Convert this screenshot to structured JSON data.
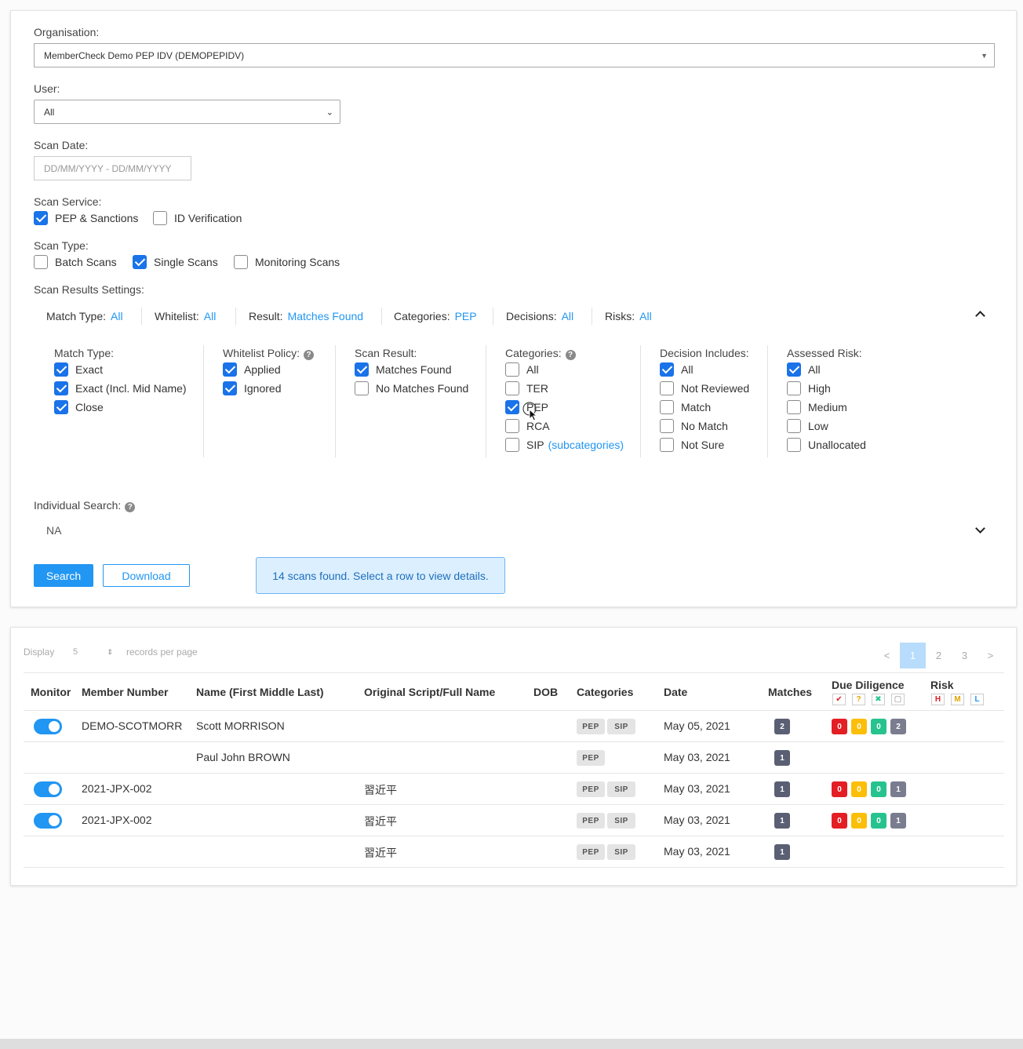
{
  "filters": {
    "organisation_label": "Organisation:",
    "organisation_value": "MemberCheck Demo PEP IDV (DEMOPEPIDV)",
    "user_label": "User:",
    "user_value": "All",
    "scan_date_label": "Scan Date:",
    "scan_date_placeholder": "DD/MM/YYYY - DD/MM/YYYY",
    "scan_service_label": "Scan Service:",
    "scan_service": [
      {
        "label": "PEP & Sanctions",
        "checked": true
      },
      {
        "label": "ID Verification",
        "checked": false
      }
    ],
    "scan_type_label": "Scan Type:",
    "scan_type": [
      {
        "label": "Batch Scans",
        "checked": false
      },
      {
        "label": "Single Scans",
        "checked": true
      },
      {
        "label": "Monitoring Scans",
        "checked": false
      }
    ],
    "results_settings_label": "Scan Results Settings:",
    "summary": [
      {
        "key": "Match Type:",
        "value": "All"
      },
      {
        "key": "Whitelist:",
        "value": "All"
      },
      {
        "key": "Result:",
        "value": "Matches Found"
      },
      {
        "key": "Categories:",
        "value": "PEP"
      },
      {
        "key": "Decisions:",
        "value": "All"
      },
      {
        "key": "Risks:",
        "value": "All"
      }
    ],
    "groups": {
      "match_type": {
        "title": "Match Type:",
        "options": [
          "Exact",
          "Exact (Incl. Mid Name)",
          "Close"
        ]
      },
      "whitelist": {
        "title": "Whitelist Policy:",
        "options": [
          "Applied",
          "Ignored"
        ]
      },
      "scan_result": {
        "title": "Scan Result:",
        "options": [
          "Matches Found",
          "No Matches Found"
        ]
      },
      "categories": {
        "title": "Categories:",
        "options": [
          "All",
          "TER",
          "PEP",
          "RCA",
          "SIP"
        ],
        "sip_link": "(subcategories)"
      },
      "decision": {
        "title": "Decision Includes:",
        "options": [
          "All",
          "Not Reviewed",
          "Match",
          "No Match",
          "Not Sure"
        ]
      },
      "risk": {
        "title": "Assessed Risk:",
        "options": [
          "All",
          "High",
          "Medium",
          "Low",
          "Unallocated"
        ]
      }
    },
    "individual_search_label": "Individual Search:",
    "individual_search_value": "NA",
    "search_button": "Search",
    "download_button": "Download",
    "info_message": "14 scans found. Select a row to view details."
  },
  "results": {
    "display_label": "Display",
    "per_page_value": "5",
    "per_page_label": "records per page",
    "pagination": {
      "prev": "<",
      "pages": [
        "1",
        "2",
        "3"
      ],
      "next": ">",
      "current": "1"
    },
    "columns": [
      "Monitor",
      "Member Number",
      "Name (First Middle Last)",
      "Original Script/Full Name",
      "DOB",
      "Categories",
      "Date",
      "Matches",
      "Due Diligence",
      "Risk"
    ],
    "risk_legend": [
      "H",
      "M",
      "L"
    ],
    "rows": [
      {
        "monitor": true,
        "member": "DEMO-SCOTMORR",
        "name": "Scott MORRISON",
        "script": "",
        "dob": "",
        "tags": [
          "PEP",
          "SIP"
        ],
        "date": "May 05, 2021",
        "matches": "2",
        "dd": [
          "0",
          "0",
          "0",
          "2"
        ]
      },
      {
        "monitor": false,
        "member": "",
        "name": "Paul John BROWN",
        "script": "",
        "dob": "",
        "tags": [
          "PEP"
        ],
        "date": "May 03, 2021",
        "matches": "1",
        "dd": []
      },
      {
        "monitor": true,
        "member": "2021-JPX-002",
        "name": "",
        "script": "習近平",
        "dob": "",
        "tags": [
          "PEP",
          "SIP"
        ],
        "date": "May 03, 2021",
        "matches": "1",
        "dd": [
          "0",
          "0",
          "0",
          "1"
        ]
      },
      {
        "monitor": true,
        "member": "2021-JPX-002",
        "name": "",
        "script": "習近平",
        "dob": "",
        "tags": [
          "PEP",
          "SIP"
        ],
        "date": "May 03, 2021",
        "matches": "1",
        "dd": [
          "0",
          "0",
          "0",
          "1"
        ]
      },
      {
        "monitor": false,
        "member": "",
        "name": "",
        "script": "習近平",
        "dob": "",
        "tags": [
          "PEP",
          "SIP"
        ],
        "date": "May 03, 2021",
        "matches": "1",
        "dd": []
      }
    ]
  },
  "colors": {
    "accent": "#2196f3",
    "dd_red": "#e31e24",
    "dd_yellow": "#fbbf0a",
    "dd_green": "#27c38e",
    "dd_grey": "#7a7d8f"
  }
}
